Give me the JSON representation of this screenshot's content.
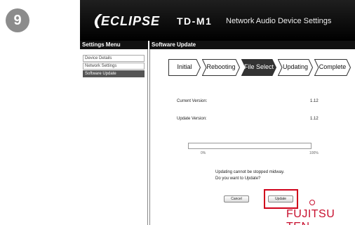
{
  "step_number": "9",
  "header": {
    "logo": "ECLIPSE",
    "model": "TD-M1",
    "product": "Network Audio Device Settings"
  },
  "sidebar": {
    "title": "Settings Menu",
    "items": [
      {
        "label": "Device Details",
        "active": false
      },
      {
        "label": "Network Settings",
        "active": false
      },
      {
        "label": "Software Update",
        "active": true
      }
    ]
  },
  "main": {
    "title": "Software Update",
    "steps": [
      {
        "label": "Initial",
        "current": false
      },
      {
        "label": "Rebooting",
        "current": false
      },
      {
        "label": "File Select",
        "current": true
      },
      {
        "label": "Updating",
        "current": false
      },
      {
        "label": "Complete",
        "current": false
      }
    ],
    "current_version_label": "Current Version:",
    "current_version": "1.12",
    "update_version_label": "Update Version:",
    "update_version": "1.12",
    "progress": 0,
    "progress_min_label": "0%",
    "progress_max_label": "100%",
    "message_line1": "Updating cannot be stopped midway.",
    "message_line2": "Do you want to Update?",
    "cancel_label": "Cancel",
    "update_label": "Update",
    "highlight_color": "#d0021b"
  },
  "brand": "FUJITSU TEN",
  "colors": {
    "accent": "#c8102e",
    "header_bg": "#000000",
    "active_step": "#333333"
  }
}
